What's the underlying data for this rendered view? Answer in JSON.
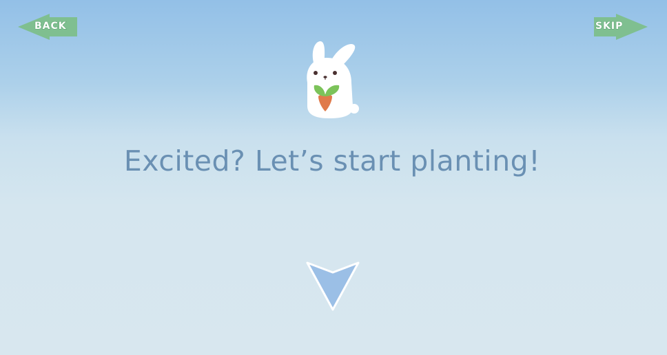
{
  "nav": {
    "back_label": "BACK",
    "skip_label": "SKIP"
  },
  "main": {
    "headline": "Excited? Let’s start planting!"
  },
  "colors": {
    "nav_arrow": "#7fbf90",
    "headline": "#6a90b3",
    "down_arrow_fill": "#9bbfe6",
    "down_arrow_stroke": "#ffffff",
    "sprout_leaf": "#7cc35a",
    "carrot": "#e07a4a"
  },
  "icons": {
    "back": "back-arrow-icon",
    "skip": "skip-arrow-icon",
    "mascot": "bunny-holding-carrot",
    "continue": "down-triangle-icon"
  }
}
